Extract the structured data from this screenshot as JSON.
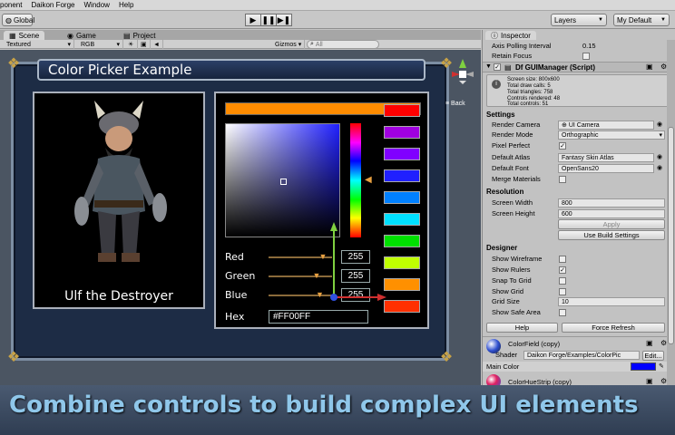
{
  "menu": [
    "ponent",
    "Daikon Forge",
    "Window",
    "Help"
  ],
  "toolbar": {
    "global": "Global",
    "layers": "Layers",
    "layout": "My Default"
  },
  "tabs": {
    "scene": "Scene",
    "game": "Game",
    "project": "Project"
  },
  "scene_bar": {
    "shading": "Textured",
    "render": "RGB",
    "gizmos": "Gizmos",
    "search": "All"
  },
  "gizmo": {
    "back": "Back"
  },
  "demo": {
    "title": "Color Picker Example",
    "character_name": "Ulf the Destroyer",
    "selected_color": "#ff8c00",
    "swatches": [
      "#ff0000",
      "#a000e0",
      "#8000ff",
      "#2020ff",
      "#0080ff",
      "#00e0ff",
      "#00e000",
      "#c0ff00",
      "#ff9000",
      "#ff3000"
    ],
    "rows": [
      {
        "label": "Red",
        "value": "255",
        "level": 0.85
      },
      {
        "label": "Green",
        "value": "255",
        "level": 0.75
      },
      {
        "label": "Blue",
        "value": "255",
        "level": 0.8
      }
    ],
    "hex_label": "Hex",
    "hex_value": "#FF00FF"
  },
  "banner": "Combine controls to build complex UI elements",
  "inspector": {
    "tab": "Inspector",
    "axis_polling_label": "Axis Polling Interval",
    "axis_polling_value": "0.15",
    "retain_focus_label": "Retain Focus",
    "component_title": "Df GUIManager (Script)",
    "info_lines": [
      "Screen size: 800x600",
      "Total draw calls: 5",
      "Total triangles: 758",
      "Controls rendered: 48",
      "Total controls: 51"
    ],
    "settings_header": "Settings",
    "render_camera_label": "Render Camera",
    "render_camera_value": "UI Camera",
    "render_mode_label": "Render Mode",
    "render_mode_value": "Orthographic",
    "pixel_perfect_label": "Pixel Perfect",
    "default_atlas_label": "Default Atlas",
    "default_atlas_value": "Fantasy Skin Atlas",
    "default_font_label": "Default Font",
    "default_font_value": "OpenSans20",
    "merge_materials_label": "Merge Materials",
    "resolution_header": "Resolution",
    "screen_width_label": "Screen Width",
    "screen_width_value": "800",
    "screen_height_label": "Screen Height",
    "screen_height_value": "600",
    "apply_label": "Apply",
    "use_build_label": "Use Build Settings",
    "designer_header": "Designer",
    "show_wireframe_label": "Show Wireframe",
    "show_rulers_label": "Show Rulers",
    "snap_to_grid_label": "Snap To Grid",
    "show_grid_label": "Show Grid",
    "grid_size_label": "Grid Size",
    "grid_size_value": "10",
    "show_safe_area_label": "Show Safe Area",
    "help_label": "Help",
    "force_refresh_label": "Force Refresh",
    "material1_name": "ColorField (copy)",
    "shader_label": "Shader",
    "shader_value": "Daikon Forge/Examples/ColorPic",
    "edit_label": "Edit...",
    "main_color_label": "Main Color",
    "main_color": "#0000ff",
    "material2_name": "ColorHueStrip (copy)"
  }
}
